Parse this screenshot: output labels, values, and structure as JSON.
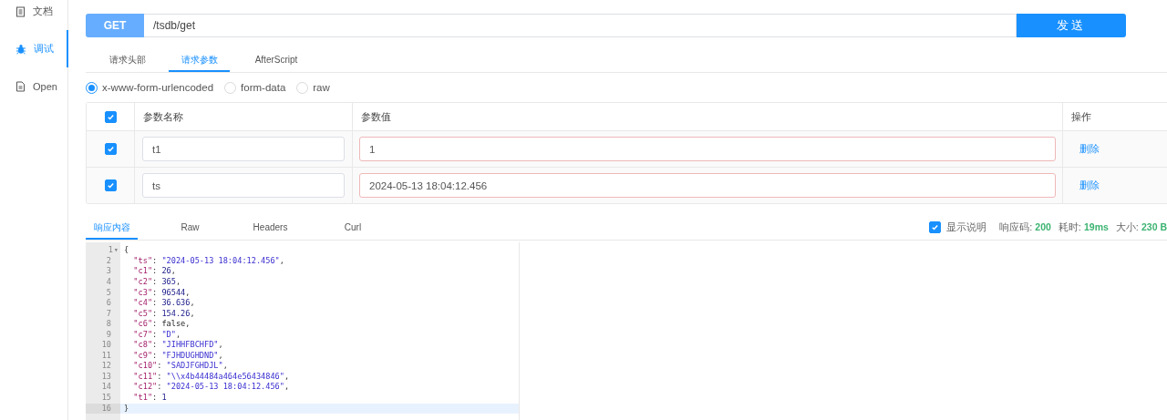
{
  "sidebar": {
    "items": [
      {
        "label": "文档",
        "kind": "doc",
        "selected": false
      },
      {
        "label": "调试",
        "kind": "bug",
        "selected": true
      },
      {
        "label": "Open",
        "kind": "file",
        "selected": false
      }
    ]
  },
  "request": {
    "method": "GET",
    "url": "/tsdb/get",
    "send": "发送"
  },
  "request_tabs": [
    {
      "label": "请求头部",
      "selected": false
    },
    {
      "label": "请求参数",
      "selected": true
    },
    {
      "label": "AfterScript",
      "selected": false
    }
  ],
  "body_types": [
    {
      "label": "x-www-form-urlencoded",
      "selected": true
    },
    {
      "label": "form-data",
      "selected": false
    },
    {
      "label": "raw",
      "selected": false
    }
  ],
  "params": {
    "all_checked": true,
    "columns": [
      "参数名称",
      "参数值",
      "操作"
    ],
    "rows": [
      {
        "checked": true,
        "name": "t1",
        "value": "1",
        "action": "删除"
      },
      {
        "checked": true,
        "name": "ts",
        "value": "2024-05-13 18:04:12.456",
        "action": "删除"
      }
    ]
  },
  "response_tabs": [
    {
      "label": "响应内容",
      "selected": true
    },
    {
      "label": "Raw",
      "selected": false
    },
    {
      "label": "Headers",
      "selected": false
    },
    {
      "label": "Curl",
      "selected": false
    }
  ],
  "response_info": {
    "show_description": {
      "label": "显示说明",
      "checked": true
    },
    "stats": [
      {
        "label": "响应码:",
        "value": "200"
      },
      {
        "label": "耗时:",
        "value": "19ms"
      },
      {
        "label": "大小:",
        "value": "230 B"
      }
    ]
  },
  "code": {
    "lines": [
      {
        "number": "1",
        "fold": "▾",
        "tokens": [
          {
            "text": "{",
            "kind": "punct"
          }
        ]
      },
      {
        "number": "2",
        "tokens": [
          {
            "text": "\"ts\"",
            "kind": "key"
          },
          {
            "text": ": ",
            "kind": "punct"
          },
          {
            "text": "\"2024-05-13 18:04:12.456\"",
            "kind": "string"
          },
          {
            "text": ",",
            "kind": "punct"
          }
        ]
      },
      {
        "number": "3",
        "tokens": [
          {
            "text": "\"c1\"",
            "kind": "key"
          },
          {
            "text": ": ",
            "kind": "punct"
          },
          {
            "text": "26",
            "kind": "number"
          },
          {
            "text": ",",
            "kind": "punct"
          }
        ]
      },
      {
        "number": "4",
        "tokens": [
          {
            "text": "\"c2\"",
            "kind": "key"
          },
          {
            "text": ": ",
            "kind": "punct"
          },
          {
            "text": "365",
            "kind": "number"
          },
          {
            "text": ",",
            "kind": "punct"
          }
        ]
      },
      {
        "number": "5",
        "tokens": [
          {
            "text": "\"c3\"",
            "kind": "key"
          },
          {
            "text": ": ",
            "kind": "punct"
          },
          {
            "text": "96544",
            "kind": "number"
          },
          {
            "text": ",",
            "kind": "punct"
          }
        ]
      },
      {
        "number": "6",
        "tokens": [
          {
            "text": "\"c4\"",
            "kind": "key"
          },
          {
            "text": ": ",
            "kind": "punct"
          },
          {
            "text": "36.636",
            "kind": "number"
          },
          {
            "text": ",",
            "kind": "punct"
          }
        ]
      },
      {
        "number": "7",
        "tokens": [
          {
            "text": "\"c5\"",
            "kind": "key"
          },
          {
            "text": ": ",
            "kind": "punct"
          },
          {
            "text": "154.26",
            "kind": "number"
          },
          {
            "text": ",",
            "kind": "punct"
          }
        ]
      },
      {
        "number": "8",
        "tokens": [
          {
            "text": "\"c6\"",
            "kind": "key"
          },
          {
            "text": ": ",
            "kind": "punct"
          },
          {
            "text": "false",
            "kind": "bool"
          },
          {
            "text": ",",
            "kind": "punct"
          }
        ]
      },
      {
        "number": "9",
        "tokens": [
          {
            "text": "\"c7\"",
            "kind": "key"
          },
          {
            "text": ": ",
            "kind": "punct"
          },
          {
            "text": "\"D\"",
            "kind": "string"
          },
          {
            "text": ",",
            "kind": "punct"
          }
        ]
      },
      {
        "number": "10",
        "tokens": [
          {
            "text": "\"c8\"",
            "kind": "key"
          },
          {
            "text": ": ",
            "kind": "punct"
          },
          {
            "text": "\"JIHHFBCHFD\"",
            "kind": "string"
          },
          {
            "text": ",",
            "kind": "punct"
          }
        ]
      },
      {
        "number": "11",
        "tokens": [
          {
            "text": "\"c9\"",
            "kind": "key"
          },
          {
            "text": ": ",
            "kind": "punct"
          },
          {
            "text": "\"FJHDUGHDND\"",
            "kind": "string"
          },
          {
            "text": ",",
            "kind": "punct"
          }
        ]
      },
      {
        "number": "12",
        "tokens": [
          {
            "text": "\"c10\"",
            "kind": "key"
          },
          {
            "text": ": ",
            "kind": "punct"
          },
          {
            "text": "\"SADJFGHDJL\"",
            "kind": "string"
          },
          {
            "text": ",",
            "kind": "punct"
          }
        ]
      },
      {
        "number": "13",
        "tokens": [
          {
            "text": "\"c11\"",
            "kind": "key"
          },
          {
            "text": ": ",
            "kind": "punct"
          },
          {
            "text": "\"\\\\x4b44484a464e56434846\"",
            "kind": "string"
          },
          {
            "text": ",",
            "kind": "punct"
          }
        ]
      },
      {
        "number": "14",
        "tokens": [
          {
            "text": "\"c12\"",
            "kind": "key"
          },
          {
            "text": ": ",
            "kind": "punct"
          },
          {
            "text": "\"2024-05-13 18:04:12.456\"",
            "kind": "string"
          },
          {
            "text": ",",
            "kind": "punct"
          }
        ]
      },
      {
        "number": "15",
        "tokens": [
          {
            "text": "\"t1\"",
            "kind": "key"
          },
          {
            "text": ": ",
            "kind": "punct"
          },
          {
            "text": "1",
            "kind": "number"
          }
        ]
      },
      {
        "number": "16",
        "active": true,
        "tokens": [
          {
            "text": "}",
            "kind": "punct"
          }
        ]
      }
    ]
  }
}
